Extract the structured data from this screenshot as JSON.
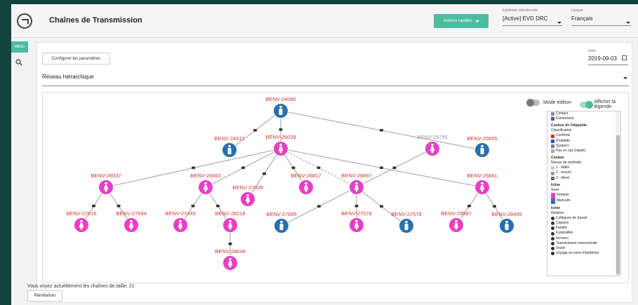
{
  "header": {
    "title": "Chaînes de Transmission",
    "actions_label": "Actions rapides",
    "outbreak_label": "Epidémie sélectionnée",
    "outbreak_value": "[Active] EVD DRC",
    "language_label": "Langue",
    "language_value": "Français"
  },
  "sidebar": {
    "menu_label": "MENU",
    "search_icon": "search-icon"
  },
  "main": {
    "configure_button": "Configurer les paramètres",
    "date_label": "Date",
    "date_value": "2019-09-03",
    "view_select": "Réseau hiérarchique",
    "toggle_edit": "Mode édition",
    "toggle_legend": "Afficher la légende",
    "chains_text": "Vous voyez actuellement les chaînes de taille: 21",
    "reset_button": "Réinitialiser"
  },
  "colors": {
    "accent": "#4cbca0",
    "female": "#e83fc4",
    "male": "#2a6fb0",
    "label_red": "#d9342b",
    "edge": "#b8b8b8"
  },
  "graph": {
    "nodes": [
      {
        "id": "BENV-24080",
        "sex": "male"
      },
      {
        "id": "BENV-24312",
        "sex": "male"
      },
      {
        "id": "BENV-26029",
        "sex": "female"
      },
      {
        "id": "BENV-29795",
        "sex": "female",
        "label_color": "#9a9a9a"
      },
      {
        "id": "BENV-25655",
        "sex": "male"
      },
      {
        "id": "BENV-26537",
        "sex": "female"
      },
      {
        "id": "BENV-26663",
        "sex": "female"
      },
      {
        "id": "BENV-27028",
        "sex": "female"
      },
      {
        "id": "BENV-26817",
        "sex": "female"
      },
      {
        "id": "BENV-26897",
        "sex": "female"
      },
      {
        "id": "BENV-26661",
        "sex": "female"
      },
      {
        "id": "BENV-27616",
        "sex": "female"
      },
      {
        "id": "BENV-27694",
        "sex": "female"
      },
      {
        "id": "BENV-27443",
        "sex": "female"
      },
      {
        "id": "BENV-28218",
        "sex": "female"
      },
      {
        "id": "BENV-27695",
        "sex": "male"
      },
      {
        "id": "BENV-27578",
        "sex": "female"
      },
      {
        "id": "BENV-27579",
        "sex": "male"
      },
      {
        "id": "BENV-29587",
        "sex": "female"
      },
      {
        "id": "BENV-28495",
        "sex": "male"
      },
      {
        "id": "BENV-28648",
        "sex": "female"
      }
    ],
    "edges": [
      [
        "BENV-24080",
        "BENV-24312"
      ],
      [
        "BENV-24080",
        "BENV-26029"
      ],
      [
        "BENV-24080",
        "BENV-25655"
      ],
      [
        "BENV-29795",
        "BENV-26897"
      ],
      [
        "BENV-26029",
        "BENV-26537"
      ],
      [
        "BENV-26029",
        "BENV-26663"
      ],
      [
        "BENV-26029",
        "BENV-27028"
      ],
      [
        "BENV-26029",
        "BENV-26817"
      ],
      [
        "BENV-26029",
        "BENV-26897",
        "dashed"
      ],
      [
        "BENV-26029",
        "BENV-26661"
      ],
      [
        "BENV-26537",
        "BENV-27616"
      ],
      [
        "BENV-26537",
        "BENV-27694"
      ],
      [
        "BENV-26663",
        "BENV-27443"
      ],
      [
        "BENV-26663",
        "BENV-28218"
      ],
      [
        "BENV-28218",
        "BENV-28648"
      ],
      [
        "BENV-26897",
        "BENV-27695"
      ],
      [
        "BENV-26897",
        "BENV-27578"
      ],
      [
        "BENV-26897",
        "BENV-27579"
      ],
      [
        "BENV-26661",
        "BENV-29587"
      ],
      [
        "BENV-26661",
        "BENV-28495"
      ]
    ]
  },
  "legend": {
    "items_top": [
      {
        "label": "Contact",
        "color": "#8a8aa8"
      },
      {
        "label": "Événement",
        "color": "#6a4a9a"
      }
    ],
    "label_color_title": "Couleur de l'étiquette",
    "label_color_sub": "Classification",
    "classification": [
      {
        "label": "Confirmé",
        "color": "#d9342b"
      },
      {
        "label": "Probable",
        "color": "#2b4ad9"
      },
      {
        "label": "Suspect",
        "color": "#7a7ab0"
      },
      {
        "label": "Pas un cas (rejeté)",
        "color": "#aaaaaa"
      }
    ],
    "color_title": "Couleur",
    "color_sub": "Niveau de certitude",
    "certainty": [
      {
        "label": "1 - faible",
        "color": "#c8c8c8"
      },
      {
        "label": "2 - moyen",
        "color": "#999999"
      },
      {
        "label": "3 - élevé",
        "color": "#666666"
      }
    ],
    "icon_title": "Icône",
    "sex_sub": "Sexe",
    "sex": [
      {
        "label": "Féminin",
        "color": "#e83fc4"
      },
      {
        "label": "Masculin",
        "color": "#2a6fb0"
      }
    ],
    "icon_title2": "Icône",
    "relation_sub": "Relation",
    "relations": [
      {
        "label": "Collègues de travail",
        "icon": "briefcase-icon"
      },
      {
        "label": "Copains",
        "icon": "friends-icon"
      },
      {
        "label": "Famille",
        "icon": "family-icon"
      },
      {
        "label": "Funérailles",
        "icon": "funeral-icon"
      },
      {
        "label": "Inconnu",
        "icon": "unknown-icon"
      },
      {
        "label": "Transmission nosocomiale",
        "icon": "hospital-icon"
      },
      {
        "label": "Voisin",
        "icon": "neighbour-icon"
      },
      {
        "label": "Voyage en zone d'épidémie",
        "icon": "travel-icon"
      }
    ]
  }
}
